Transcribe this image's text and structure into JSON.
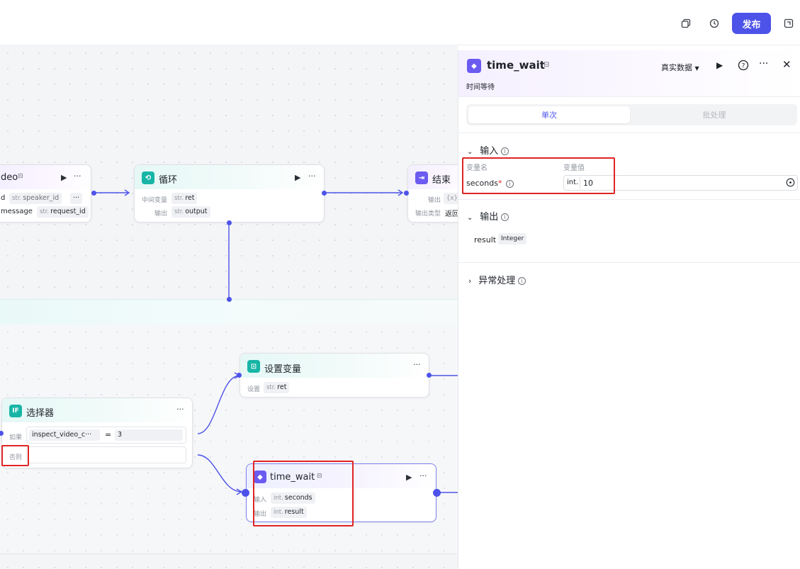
{
  "toolbar": {
    "copy_icon": "copy-icon",
    "history_icon": "history-icon",
    "publish_label": "发布",
    "extra_icon": "panel-icon"
  },
  "canvas": {
    "video_node": {
      "title": "deo",
      "row1": {
        "label": "d",
        "tag_type": "str.",
        "tag": "speaker_id",
        "more": "···"
      },
      "row2": {
        "label": "message",
        "tag_type": "str.",
        "tag": "request_id"
      }
    },
    "loop_node": {
      "title": "循环",
      "row1": {
        "label": "中间变量",
        "tag_type": "str.",
        "tag": "ret"
      },
      "row2": {
        "label": "输出",
        "tag_type": "str.",
        "tag": "output"
      }
    },
    "end_node": {
      "title": "结束",
      "row1": {
        "label": "输出",
        "tag_type": "{x}"
      },
      "row2": {
        "label": "输出类型",
        "value": "返回"
      }
    },
    "setvar_node": {
      "title": "设置变量",
      "row1": {
        "label": "设置",
        "tag_type": "str.",
        "tag": "ret"
      }
    },
    "selector_node": {
      "icon_text": "IF",
      "title": "选择器",
      "if_label": "如果",
      "condition_var": "inspect_video_c···",
      "operator": "=",
      "condition_value": "3",
      "else_label": "否则"
    },
    "timewait_node": {
      "title": "time_wait",
      "row1": {
        "label": "输入",
        "tag_type": "int.",
        "tag": "seconds"
      },
      "row2": {
        "label": "输出",
        "tag_type": "int.",
        "tag": "result"
      }
    }
  },
  "panel": {
    "title": "time_wait",
    "subtitle": "时间等待",
    "data_source": "真实数据",
    "tabs": {
      "active": "单次",
      "other": "批处理"
    },
    "input_section": {
      "title": "输入",
      "col_name": "变量名",
      "col_value": "变量值",
      "var_name": "seconds",
      "required_mark": "*",
      "type_prefix": "int.",
      "value": "10"
    },
    "output_section": {
      "title": "输出",
      "var_name": "result",
      "type": "Integer"
    },
    "exception_section": {
      "title": "异常处理"
    }
  },
  "colors": {
    "accent": "#4d53e8",
    "highlight": "#e02424",
    "teal": "#17b5a6"
  }
}
